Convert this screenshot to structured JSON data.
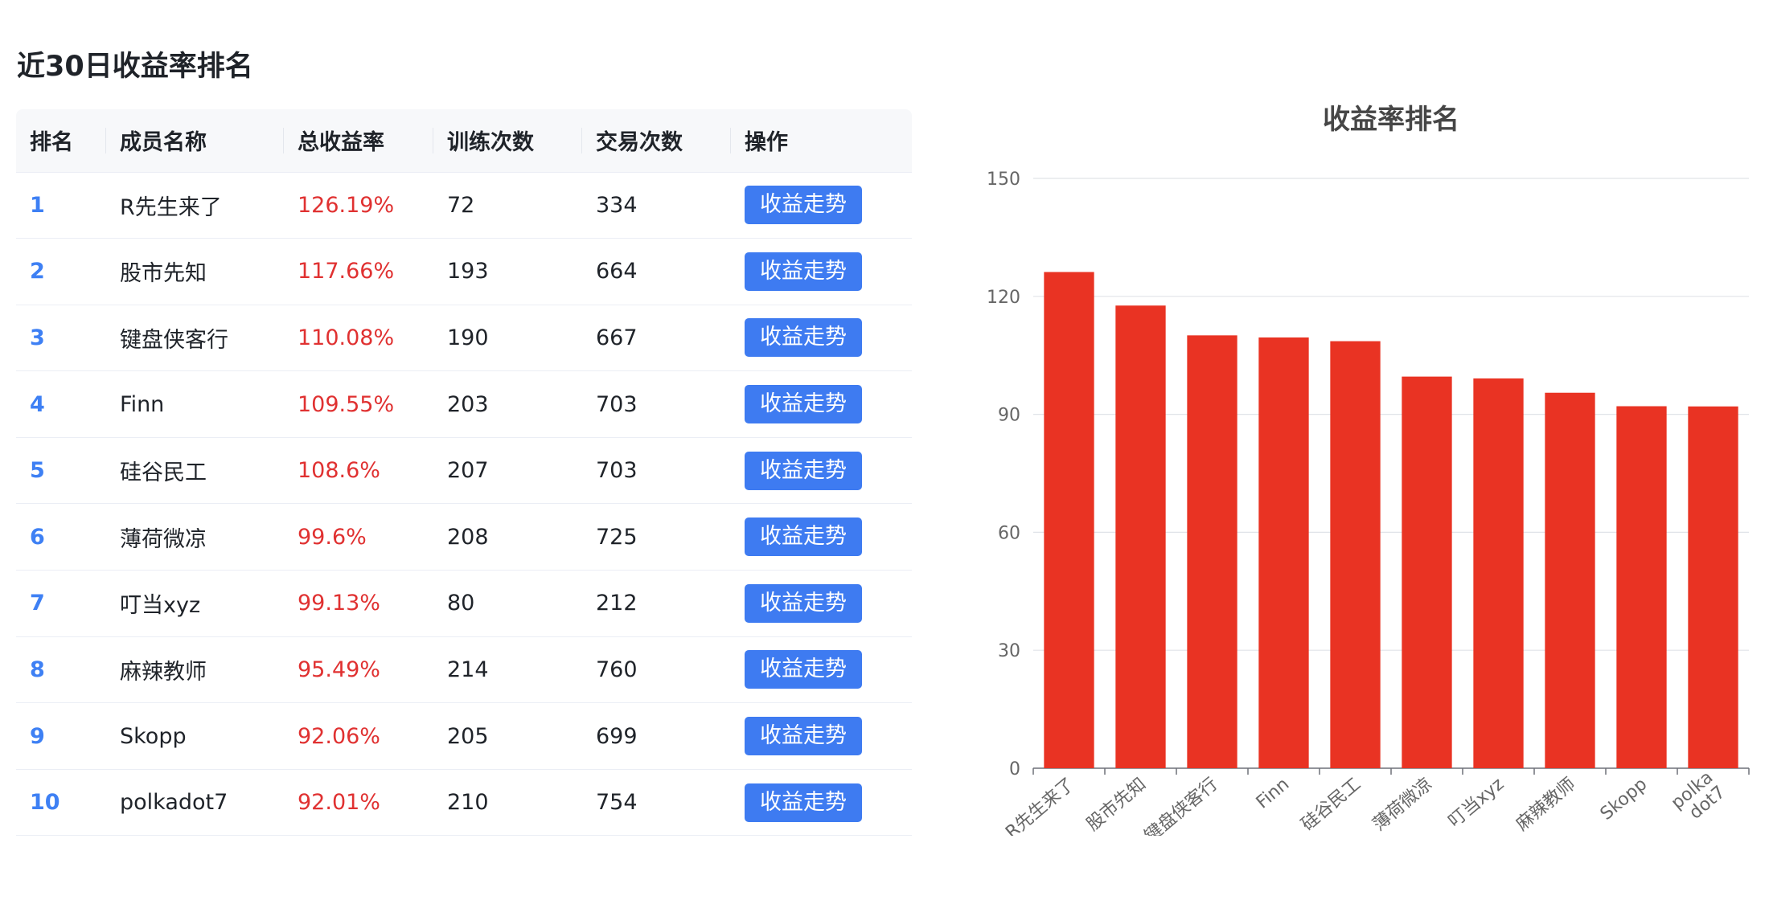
{
  "page": {
    "title": "近30日收益率排名"
  },
  "table": {
    "columns": [
      "排名",
      "成员名称",
      "总收益率",
      "训练次数",
      "交易次数",
      "操作"
    ],
    "action_label": "收益走势",
    "rows": [
      {
        "rank": "1",
        "name": "R先生来了",
        "yield": "126.19%",
        "trainings": "72",
        "trades": "334"
      },
      {
        "rank": "2",
        "name": "股市先知",
        "yield": "117.66%",
        "trainings": "193",
        "trades": "664"
      },
      {
        "rank": "3",
        "name": "键盘侠客行",
        "yield": "110.08%",
        "trainings": "190",
        "trades": "667"
      },
      {
        "rank": "4",
        "name": "Finn",
        "yield": "109.55%",
        "trainings": "203",
        "trades": "703"
      },
      {
        "rank": "5",
        "name": "硅谷民工",
        "yield": "108.6%",
        "trainings": "207",
        "trades": "703"
      },
      {
        "rank": "6",
        "name": "薄荷微凉",
        "yield": "99.6%",
        "trainings": "208",
        "trades": "725"
      },
      {
        "rank": "7",
        "name": "叮当xyz",
        "yield": "99.13%",
        "trainings": "80",
        "trades": "212"
      },
      {
        "rank": "8",
        "name": "麻辣教师",
        "yield": "95.49%",
        "trainings": "214",
        "trades": "760"
      },
      {
        "rank": "9",
        "name": "Skopp",
        "yield": "92.06%",
        "trainings": "205",
        "trades": "699"
      },
      {
        "rank": "10",
        "name": "polkadot7",
        "yield": "92.01%",
        "trainings": "210",
        "trades": "754"
      }
    ]
  },
  "colors": {
    "accent": "#3e7bf1",
    "rank": "#3e80f4",
    "yield": "#e03131",
    "bar": "#e93323"
  },
  "chart_data": {
    "type": "bar",
    "title": "收益率排名",
    "categories": [
      "R先生来了",
      "股市先知",
      "键盘侠客行",
      "Finn",
      "硅谷民工",
      "薄荷微凉",
      "叮当xyz",
      "麻辣教师",
      "Skopp",
      "polkadot7"
    ],
    "category_labels": [
      [
        "R先生来了"
      ],
      [
        "股市先知"
      ],
      [
        "键盘侠客行"
      ],
      [
        "Finn"
      ],
      [
        "硅谷民工"
      ],
      [
        "薄荷微凉"
      ],
      [
        "叮当xyz"
      ],
      [
        "麻辣教师"
      ],
      [
        "Skopp"
      ],
      [
        "polka",
        "dot7"
      ]
    ],
    "values": [
      126.19,
      117.66,
      110.08,
      109.55,
      108.6,
      99.6,
      99.13,
      95.49,
      92.06,
      92.01
    ],
    "ylim": [
      0,
      150
    ],
    "yticks": [
      0,
      30,
      60,
      90,
      120,
      150
    ],
    "grid": true,
    "xlabel": "",
    "ylabel": ""
  }
}
